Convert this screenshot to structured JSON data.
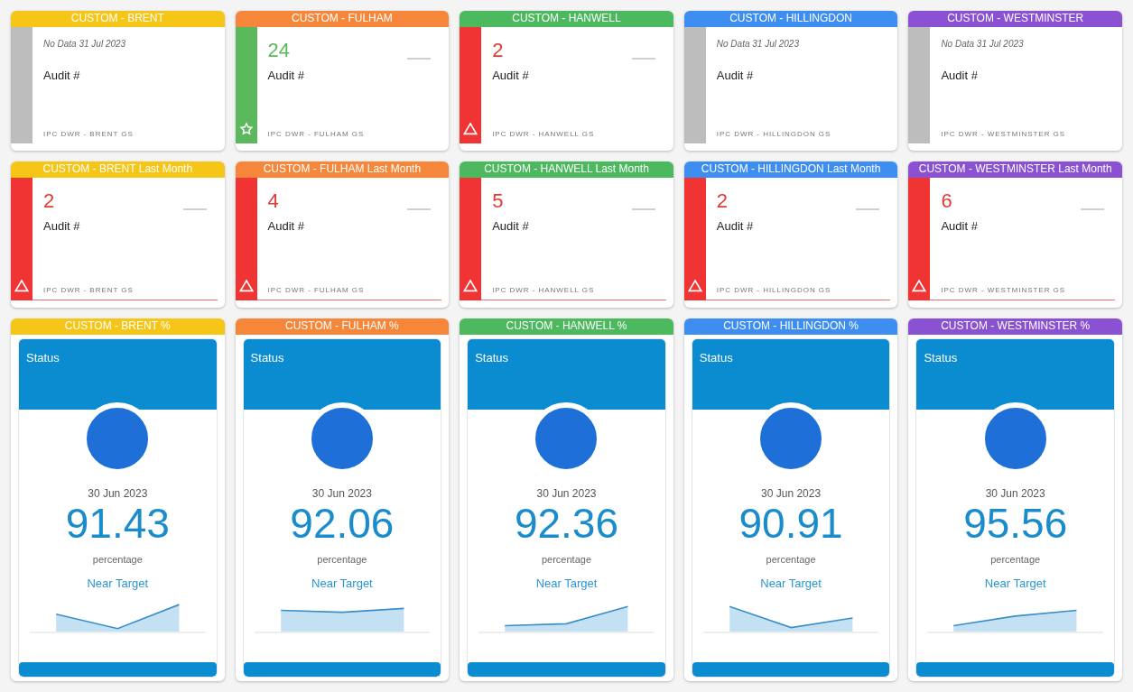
{
  "tile_rows": [
    {
      "tiles": [
        {
          "title": "CUSTOM - BRENT",
          "color": "#f5c518",
          "kind": "none",
          "note": "No Data 31 Jul 2023",
          "label": "Audit #",
          "source": "IPC DWR - BRENT GS"
        },
        {
          "title": "CUSTOM - FULHAM",
          "color": "#f5863a",
          "kind": "good",
          "value": "24",
          "label": "Audit #",
          "source": "IPC DWR - FULHAM GS"
        },
        {
          "title": "CUSTOM - HANWELL",
          "color": "#4cb95e",
          "kind": "alert",
          "value": "2",
          "label": "Audit #",
          "source": "IPC DWR - HANWELL GS"
        },
        {
          "title": "CUSTOM - HILLINGDON",
          "color": "#3d8ef0",
          "kind": "none",
          "note": "No Data 31 Jul 2023",
          "label": "Audit #",
          "source": "IPC DWR - HILLINGDON GS"
        },
        {
          "title": "CUSTOM - WESTMINSTER",
          "color": "#8a52d2",
          "kind": "none",
          "note": "No Data 31 Jul 2023",
          "label": "Audit #",
          "source": "IPC DWR - WESTMINSTER GS"
        }
      ]
    },
    {
      "tiles": [
        {
          "title": "CUSTOM - BRENT Last Month",
          "color": "#f5c518",
          "kind": "alert",
          "value": "2",
          "label": "Audit #",
          "source": "IPC DWR - BRENT GS"
        },
        {
          "title": "CUSTOM - FULHAM Last Month",
          "color": "#f5863a",
          "kind": "alert",
          "value": "4",
          "label": "Audit #",
          "source": "IPC DWR - FULHAM GS"
        },
        {
          "title": "CUSTOM - HANWELL Last Month",
          "color": "#4cb95e",
          "kind": "alert",
          "value": "5",
          "label": "Audit #",
          "source": "IPC DWR - HANWELL GS"
        },
        {
          "title": "CUSTOM - HILLINGDON Last Month",
          "color": "#3d8ef0",
          "kind": "alert",
          "value": "2",
          "label": "Audit #",
          "source": "IPC DWR - HILLINGDON GS"
        },
        {
          "title": "CUSTOM - WESTMINSTER Last Month",
          "color": "#8a52d2",
          "kind": "alert",
          "value": "6",
          "label": "Audit #",
          "source": "IPC DWR - WESTMINSTER GS"
        }
      ]
    }
  ],
  "kpis": [
    {
      "title": "CUSTOM - BRENT %",
      "color": "#f5c518",
      "heading": "Status",
      "date": "30 Jun 2023",
      "value": "91.43",
      "unit": "percentage",
      "rating": "Near Target"
    },
    {
      "title": "CUSTOM - FULHAM %",
      "color": "#f5863a",
      "heading": "Status",
      "date": "30 Jun 2023",
      "value": "92.06",
      "unit": "percentage",
      "rating": "Near Target"
    },
    {
      "title": "CUSTOM - HANWELL %",
      "color": "#4cb95e",
      "heading": "Status",
      "date": "30 Jun 2023",
      "value": "92.36",
      "unit": "percentage",
      "rating": "Near Target"
    },
    {
      "title": "CUSTOM - HILLINGDON %",
      "color": "#3d8ef0",
      "heading": "Status",
      "date": "30 Jun 2023",
      "value": "90.91",
      "unit": "percentage",
      "rating": "Near Target"
    },
    {
      "title": "CUSTOM - WESTMINSTER %",
      "color": "#8a52d2",
      "heading": "Status",
      "date": "30 Jun 2023",
      "value": "95.56",
      "unit": "percentage",
      "rating": "Near Target"
    }
  ]
}
